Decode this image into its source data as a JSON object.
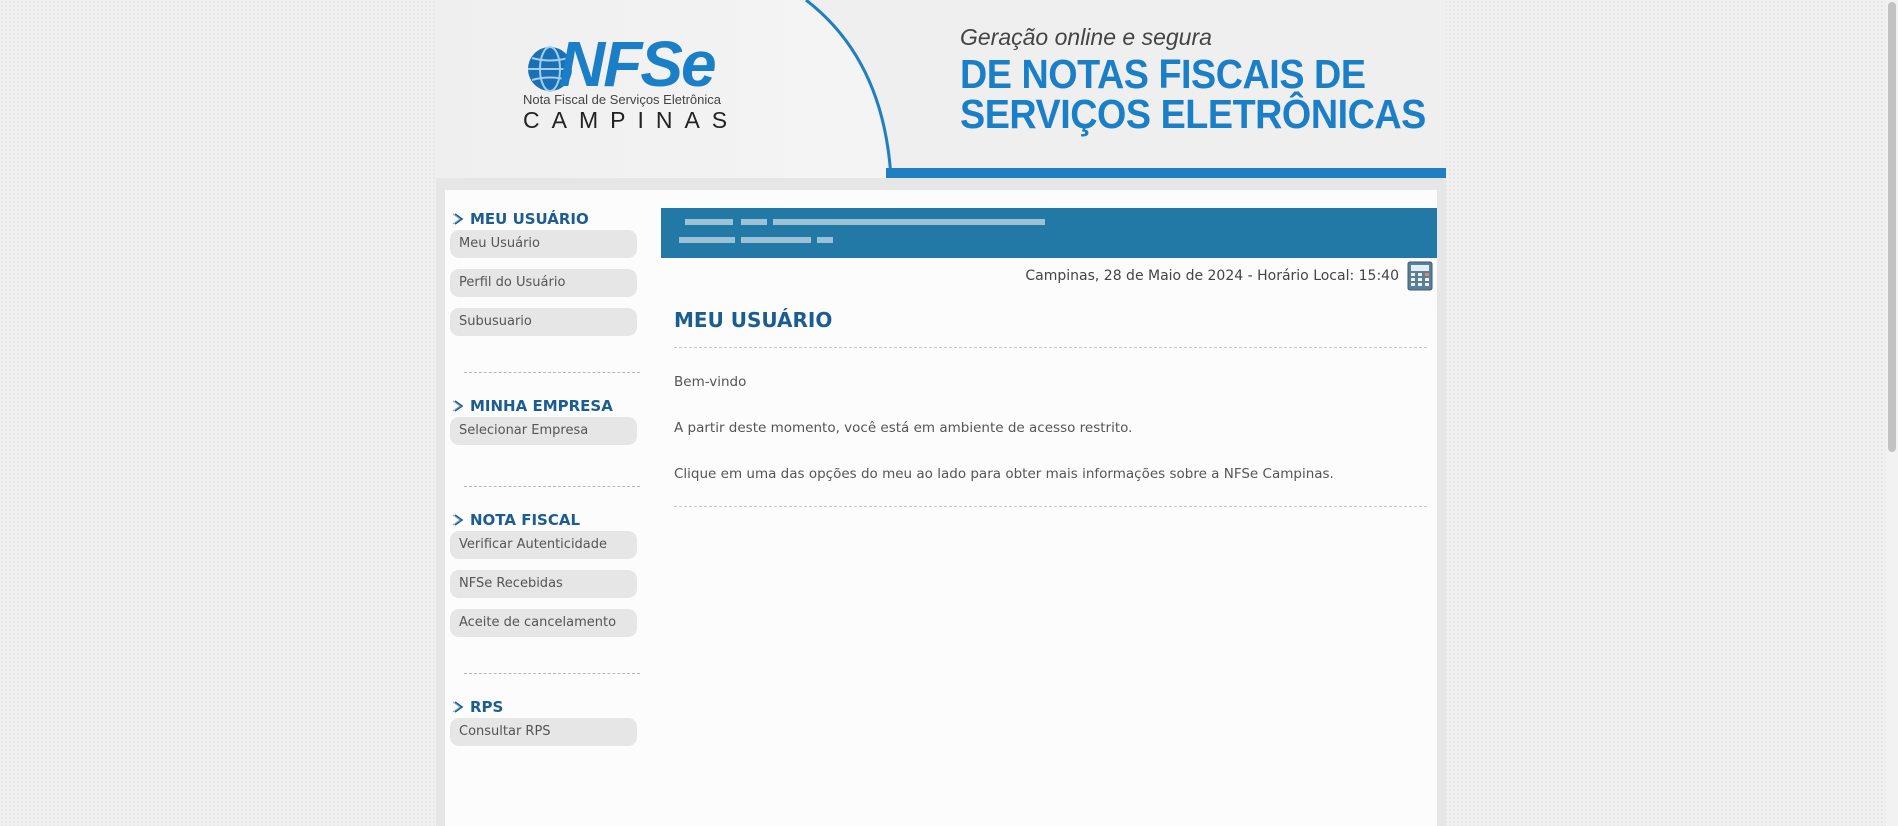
{
  "header": {
    "logo_name": "NFSe",
    "logo_subtitle": "Nota Fiscal de Serviços Eletrônica",
    "logo_city": "CAMPINAS",
    "tagline": "Geração online e segura",
    "headline_line1": "DE NOTAS FISCAIS DE",
    "headline_line2": "SERVIÇOS ELETRÔNICAS",
    "brand_color": "#1a7fc6"
  },
  "sidebar": {
    "sections": [
      {
        "title": "MEU USUÁRIO",
        "items": [
          "Meu Usuário",
          "Perfil do Usuário",
          "Subusuario"
        ]
      },
      {
        "title": "MINHA EMPRESA",
        "items": [
          "Selecionar Empresa"
        ]
      },
      {
        "title": "NOTA FISCAL",
        "items": [
          "Verificar Autenticidade",
          "NFSe Recebidas",
          "Aceite de cancelamento"
        ]
      },
      {
        "title": "RPS",
        "items": [
          "Consultar RPS"
        ]
      }
    ]
  },
  "main": {
    "datetime": "Campinas, 28 de Maio de 2024 - Horário Local: 15:40",
    "calculator_icon": "calculator-icon",
    "title": "MEU USUÁRIO",
    "paragraphs": [
      "Bem-vindo",
      "A partir deste momento, você está em ambiente de acesso restrito.",
      "Clique em uma das opções do meu ao lado para obter mais informações sobre a NFSe Campinas."
    ],
    "banner_color": "#2279a6",
    "title_color": "#1b5c92"
  }
}
